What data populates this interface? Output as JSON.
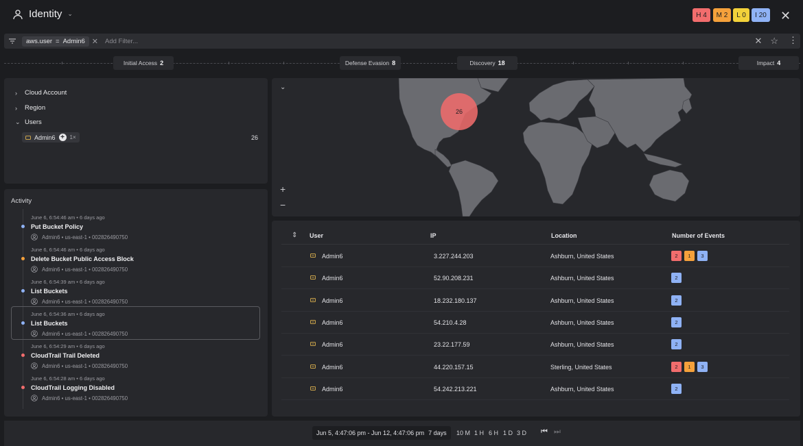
{
  "header": {
    "title": "Identity"
  },
  "severity": [
    {
      "label": "H 4",
      "color": "#f26d6d"
    },
    {
      "label": "M 2",
      "color": "#f5a13b"
    },
    {
      "label": "L 0",
      "color": "#f3d23a"
    },
    {
      "label": "I 20",
      "color": "#8fb2f5"
    }
  ],
  "filter": {
    "key": "aws.user",
    "op": "=",
    "value": "Admin6",
    "placeholder": "Add Filter..."
  },
  "tactics": [
    {
      "name": "Initial Access",
      "count": "2"
    },
    {
      "name": "Defense Evasion",
      "count": "8"
    },
    {
      "name": "Discovery",
      "count": "18"
    },
    {
      "name": "Impact",
      "count": "4"
    }
  ],
  "facets": {
    "cloud_account": "Cloud Account",
    "region": "Region",
    "users": "Users",
    "user_chip": {
      "name": "Admin6",
      "multiplier": "1×",
      "count": "26"
    }
  },
  "activity": {
    "title": "Activity",
    "items": [
      {
        "time": "June 6, 6:54:46 am • 6 days ago",
        "name": "Put Bucket Policy",
        "meta": "Admin6 • us-east-1 • 002826490750",
        "color": "#8fb2f5"
      },
      {
        "time": "June 6, 6:54:46 am • 6 days ago",
        "name": "Delete Bucket Public Access Block",
        "meta": "Admin6 • us-east-1 • 002826490750",
        "color": "#f5a13b"
      },
      {
        "time": "June 6, 6:54:39 am • 6 days ago",
        "name": "List Buckets",
        "meta": "Admin6 • us-east-1 • 002826490750",
        "color": "#8fb2f5"
      },
      {
        "time": "June 6, 6:54:36 am • 6 days ago",
        "name": "List Buckets",
        "meta": "Admin6 • us-east-1 • 002826490750",
        "color": "#8fb2f5"
      },
      {
        "time": "June 6, 6:54:29 am • 6 days ago",
        "name": "CloudTrail Trail Deleted",
        "meta": "Admin6 • us-east-1 • 002826490750",
        "color": "#f26d6d"
      },
      {
        "time": "June 6, 6:54:28 am • 6 days ago",
        "name": "CloudTrail Logging Disabled",
        "meta": "Admin6 • us-east-1 • 002826490750",
        "color": "#f26d6d"
      }
    ]
  },
  "map": {
    "cluster_count": "26",
    "zoom_in": "+",
    "zoom_out": "−"
  },
  "table": {
    "columns": [
      "User",
      "IP",
      "Location",
      "Number of Events"
    ],
    "rows": [
      {
        "user": "Admin6",
        "ip": "3.227.244.203",
        "location": "Ashburn, United States",
        "events": [
          {
            "v": "2",
            "c": "#f26d6d"
          },
          {
            "v": "1",
            "c": "#f5a13b"
          },
          {
            "v": "3",
            "c": "#8fb2f5"
          }
        ]
      },
      {
        "user": "Admin6",
        "ip": "52.90.208.231",
        "location": "Ashburn, United States",
        "events": [
          {
            "v": "2",
            "c": "#8fb2f5"
          }
        ]
      },
      {
        "user": "Admin6",
        "ip": "18.232.180.137",
        "location": "Ashburn, United States",
        "events": [
          {
            "v": "2",
            "c": "#8fb2f5"
          }
        ]
      },
      {
        "user": "Admin6",
        "ip": "54.210.4.28",
        "location": "Ashburn, United States",
        "events": [
          {
            "v": "2",
            "c": "#8fb2f5"
          }
        ]
      },
      {
        "user": "Admin6",
        "ip": "23.22.177.59",
        "location": "Ashburn, United States",
        "events": [
          {
            "v": "2",
            "c": "#8fb2f5"
          }
        ]
      },
      {
        "user": "Admin6",
        "ip": "44.220.157.15",
        "location": "Sterling, United States",
        "events": [
          {
            "v": "2",
            "c": "#f26d6d"
          },
          {
            "v": "1",
            "c": "#f5a13b"
          },
          {
            "v": "3",
            "c": "#8fb2f5"
          }
        ]
      },
      {
        "user": "Admin6",
        "ip": "54.242.213.221",
        "location": "Ashburn, United States",
        "events": [
          {
            "v": "2",
            "c": "#8fb2f5"
          }
        ]
      }
    ]
  },
  "footer": {
    "range": "Jun 5, 4:47:06 pm - Jun 12, 4:47:06 pm",
    "span": "7 days",
    "zooms": [
      "10 M",
      "1 H",
      "6 H",
      "1 D",
      "3 D"
    ]
  }
}
